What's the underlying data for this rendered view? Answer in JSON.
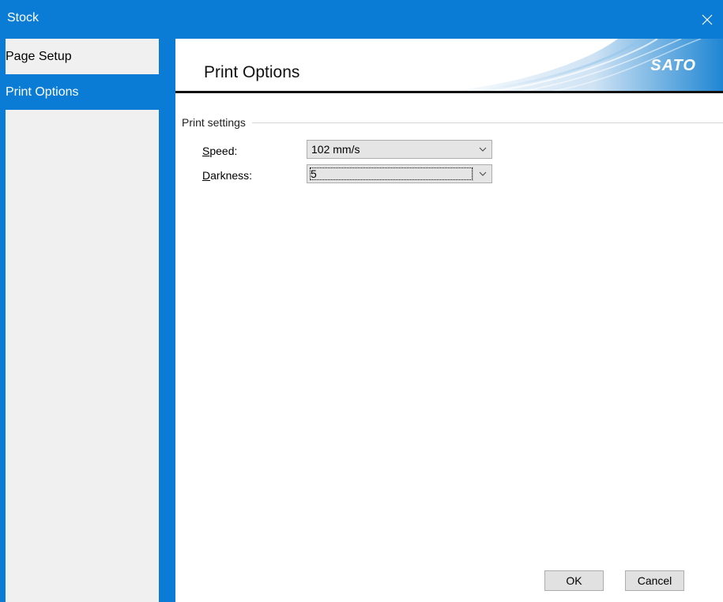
{
  "window": {
    "title": "Stock",
    "close_icon": "close-icon"
  },
  "sidebar": {
    "items": [
      {
        "label": "Page Setup",
        "selected": false
      },
      {
        "label": "Print Options",
        "selected": true
      }
    ]
  },
  "header": {
    "title": "Print Options",
    "logo_text": "SATO"
  },
  "group": {
    "title": "Print settings"
  },
  "fields": {
    "speed": {
      "label_accel": "S",
      "label_rest": "peed:",
      "value": "102 mm/s"
    },
    "darkness": {
      "label_accel": "D",
      "label_rest": "arkness:",
      "value": "5"
    }
  },
  "buttons": {
    "ok": "OK",
    "cancel": "Cancel"
  },
  "colors": {
    "accent": "#0a7cd6",
    "sidebar_bg": "#f0f0f0"
  }
}
